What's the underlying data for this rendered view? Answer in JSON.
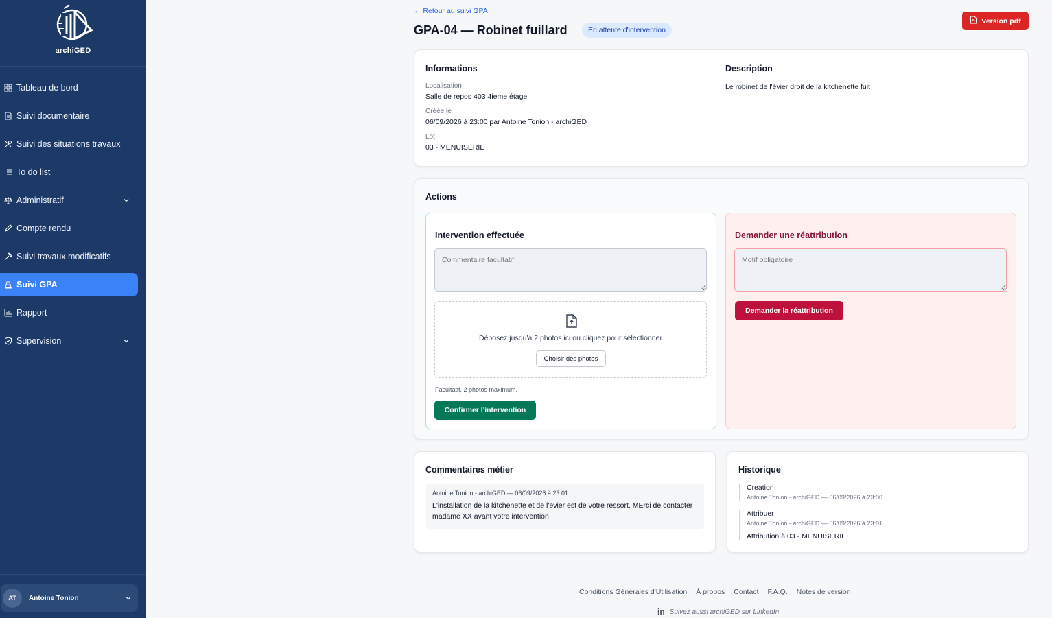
{
  "brand": {
    "name": "archiGED"
  },
  "sidebar": {
    "items": [
      {
        "label": "Tableau de bord",
        "icon": "grid-icon"
      },
      {
        "label": "Suivi documentaire",
        "icon": "document-icon"
      },
      {
        "label": "Suivi des situations travaux",
        "icon": "tools-icon"
      },
      {
        "label": "To do list",
        "icon": "list-icon"
      },
      {
        "label": "Administratif",
        "icon": "scale-icon",
        "expandable": true
      },
      {
        "label": "Compte rendu",
        "icon": "pen-icon"
      },
      {
        "label": "Suivi travaux modificatifs",
        "icon": "hammer-icon"
      },
      {
        "label": "Suivi GPA",
        "icon": "cone-icon",
        "active": true
      },
      {
        "label": "Rapport",
        "icon": "bar-chart-icon"
      },
      {
        "label": "Supervision",
        "icon": "shield-icon",
        "expandable": true
      }
    ],
    "user": {
      "initials": "AT",
      "name": "Antoine Tonion"
    }
  },
  "header": {
    "back_link": "← Retour au suivi GPA",
    "title": "GPA-04 — Robinet fuillard",
    "status": "En attente d'intervention",
    "pdf_button": "Version pdf"
  },
  "info": {
    "title": "Informations",
    "fields": [
      {
        "label": "Localisation",
        "value": "Salle de repos 403 4ieme étage"
      },
      {
        "label": "Créée le",
        "value": "06/09/2026 à 23:00 par Antoine Tonion - archiGED"
      },
      {
        "label": "Lot",
        "value": "03 - MENUISERIE"
      }
    ],
    "description_title": "Description",
    "description": "Le robinet de l'évier droit de la kitchenette fuit"
  },
  "actions": {
    "title": "Actions",
    "intervention": {
      "title": "Intervention effectuée",
      "comment_placeholder": "Commentaire facultatif",
      "dropzone_text": "Déposez jusqu'à 2 photos ici ou cliquez pour sélectionner",
      "choose_button": "Choisir des photos",
      "hint": "Facultatif, 2 photos maximum.",
      "confirm_button": "Confirmer l'intervention"
    },
    "reassign": {
      "title": "Demander une réattribution",
      "reason_placeholder": "Motif obligatoire",
      "button": "Demander la réattribution"
    }
  },
  "comments": {
    "title": "Commentaires métier",
    "items": [
      {
        "meta": "Antoine Tonion - archiGED — 06/09/2026 à 23:01",
        "text": "L'installation de la kitchenette et de l'evier est de votre ressort. MErci de contacter madame XX avant votre intervention"
      }
    ]
  },
  "history": {
    "title": "Historique",
    "items": [
      {
        "title": "Creation",
        "meta": "Antoine Tonion - archiGED — 06/09/2026 à 23:00",
        "detail": ""
      },
      {
        "title": "Attribuer",
        "meta": "Antoine Tonion - archiGED — 06/09/2026 à 23:01",
        "detail": "Attribution à 03 - MENUISERIE"
      }
    ]
  },
  "footer": {
    "links": [
      "Conditions Générales d'Utilisation",
      "À propos",
      "Contact",
      "F.A.Q.",
      "Notes de version"
    ],
    "linkedin": "Suivez aussi archiGED sur LinkedIn"
  },
  "colors": {
    "sidebar_bg": "#1c3967",
    "active_nav": "#3b82f6",
    "pdf_red": "#dc2626",
    "confirm_green": "#047857",
    "reassign_red": "#be123c"
  }
}
